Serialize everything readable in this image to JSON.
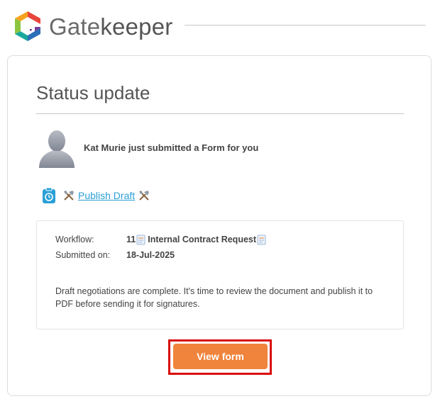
{
  "header": {
    "brand_gate": "Gate",
    "brand_keeper": "keeper"
  },
  "card": {
    "title": "Status update",
    "submitter_line": "Kat Murie just submitted a Form for you",
    "task": {
      "label": " Publish Draft ",
      "icon_left": "tools-icon",
      "icon_right": "tools-icon",
      "clipboard_icon": "clipboard-clock-icon"
    },
    "details": {
      "workflow_label": "Workflow:",
      "workflow_number": "11",
      "workflow_name": " Internal Contract Request ",
      "submitted_label": "Submitted on:",
      "submitted_value": "18-Jul-2025",
      "message": "Draft negotiations are complete. It's time to review the document and publish it to PDF before sending it for signatures."
    },
    "cta": {
      "label": "View form",
      "color": "#f0843c",
      "highlight_color": "#d90b0b"
    }
  },
  "colors": {
    "link": "#2a9fd6",
    "text": "#444444",
    "title": "#555555"
  }
}
